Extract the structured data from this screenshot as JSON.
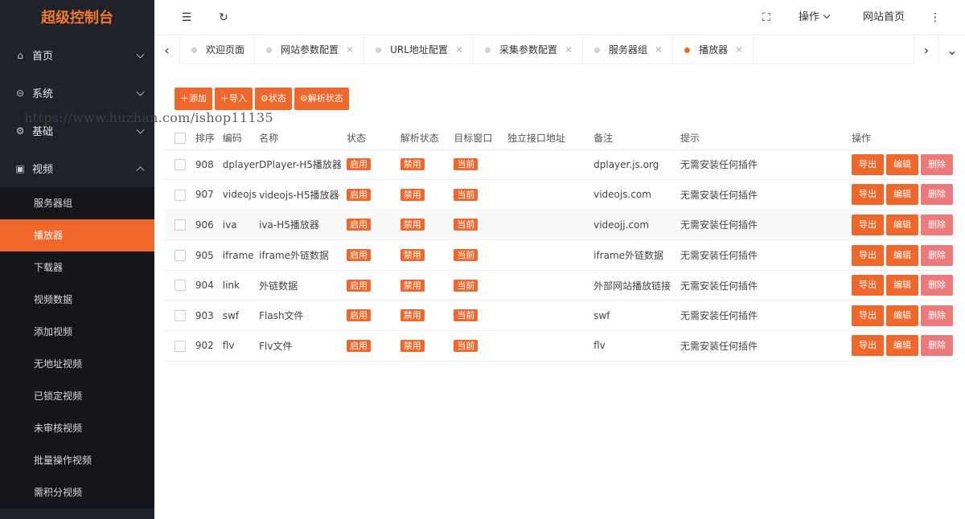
{
  "logo": "超级控制台",
  "sidebar": {
    "items": [
      {
        "label": "首页",
        "icon": "home-icon"
      },
      {
        "label": "系统",
        "icon": "system-icon"
      },
      {
        "label": "基础",
        "icon": "gear-icon"
      },
      {
        "label": "视频",
        "icon": "video-icon"
      }
    ],
    "video_sub": [
      "服务器组",
      "播放器",
      "下载器",
      "视频数据",
      "添加视频",
      "无地址视频",
      "已锁定视频",
      "未审核视频",
      "批量操作视频",
      "需积分视频"
    ]
  },
  "header": {
    "ops_label": "操作",
    "home_label": "网站首页"
  },
  "tabs": [
    "欢迎页面",
    "网站参数配置",
    "URL地址配置",
    "采集参数配置",
    "服务器组",
    "播放器"
  ],
  "toolbar": {
    "add": "＋添加",
    "import": "＋导入",
    "status": "状态",
    "parse_status": "解析状态"
  },
  "table": {
    "headers": [
      "排序",
      "编码",
      "名称",
      "状态",
      "解析状态",
      "目标窗口",
      "独立接口地址",
      "备注",
      "提示",
      "操作"
    ],
    "rows": [
      {
        "sort": "908",
        "code": "dplayer",
        "name": "DPlayer-H5播放器",
        "status": "启用",
        "parse": "禁用",
        "target": "当前",
        "api": "",
        "note": "dplayer.js.org",
        "tip": "无需安装任何插件"
      },
      {
        "sort": "907",
        "code": "videojs",
        "name": "videojs-H5播放器",
        "status": "启用",
        "parse": "禁用",
        "target": "当前",
        "api": "",
        "note": "videojs.com",
        "tip": "无需安装任何插件"
      },
      {
        "sort": "906",
        "code": "iva",
        "name": "iva-H5播放器",
        "status": "启用",
        "parse": "禁用",
        "target": "当前",
        "api": "",
        "note": "videojj.com",
        "tip": "无需安装任何插件"
      },
      {
        "sort": "905",
        "code": "iframe",
        "name": "iframe外链数据",
        "status": "启用",
        "parse": "禁用",
        "target": "当前",
        "api": "",
        "note": "iframe外链数据",
        "tip": "无需安装任何插件"
      },
      {
        "sort": "904",
        "code": "link",
        "name": "外链数据",
        "status": "启用",
        "parse": "禁用",
        "target": "当前",
        "api": "",
        "note": "外部网站播放链接",
        "tip": "无需安装任何插件"
      },
      {
        "sort": "903",
        "code": "swf",
        "name": "Flash文件",
        "status": "启用",
        "parse": "禁用",
        "target": "当前",
        "api": "",
        "note": "swf",
        "tip": "无需安装任何插件"
      },
      {
        "sort": "902",
        "code": "flv",
        "name": "Flv文件",
        "status": "启用",
        "parse": "禁用",
        "target": "当前",
        "api": "",
        "note": "flv",
        "tip": "无需安装任何插件"
      }
    ],
    "actions": {
      "export": "导出",
      "edit": "编辑",
      "delete": "删除"
    }
  },
  "watermark": "https://www.huzhan.com/ishop11135",
  "colors": {
    "accent": "#f0672b",
    "sidebar": "#20222a",
    "delete": "#ec7a7a"
  }
}
